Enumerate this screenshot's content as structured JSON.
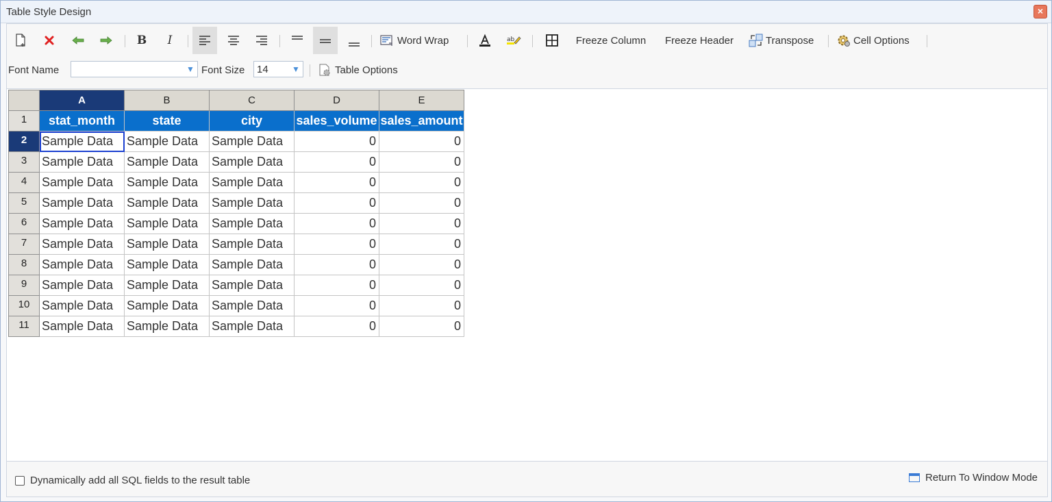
{
  "window": {
    "title": "Table Style Design",
    "close_label": "×"
  },
  "toolbar": {
    "word_wrap": "Word Wrap",
    "freeze_column": "Freeze Column",
    "freeze_header": "Freeze Header",
    "transpose": "Transpose",
    "cell_options": "Cell Options",
    "bold": "B",
    "italic": "I"
  },
  "fontbar": {
    "font_name_label": "Font Name",
    "font_name_value": "",
    "font_size_label": "Font Size",
    "font_size_value": "14",
    "table_options": "Table Options"
  },
  "grid": {
    "columns": [
      "A",
      "B",
      "C",
      "D",
      "E"
    ],
    "header_row": [
      "stat_month",
      "state",
      "city",
      "sales_volume",
      "sales_amount"
    ],
    "row_numbers": [
      "1",
      "2",
      "3",
      "4",
      "5",
      "6",
      "7",
      "8",
      "9",
      "10",
      "11"
    ],
    "sample_text": "Sample Data",
    "sample_number": "0",
    "selected_column": "A",
    "selected_row": "2"
  },
  "footer": {
    "checkbox_label": "Dynamically add all SQL fields to the result table",
    "return_label": "Return To Window Mode"
  },
  "colors": {
    "header_fill": "#0a6fcc",
    "selection": "#1a3a78",
    "close": "#e8775b"
  }
}
